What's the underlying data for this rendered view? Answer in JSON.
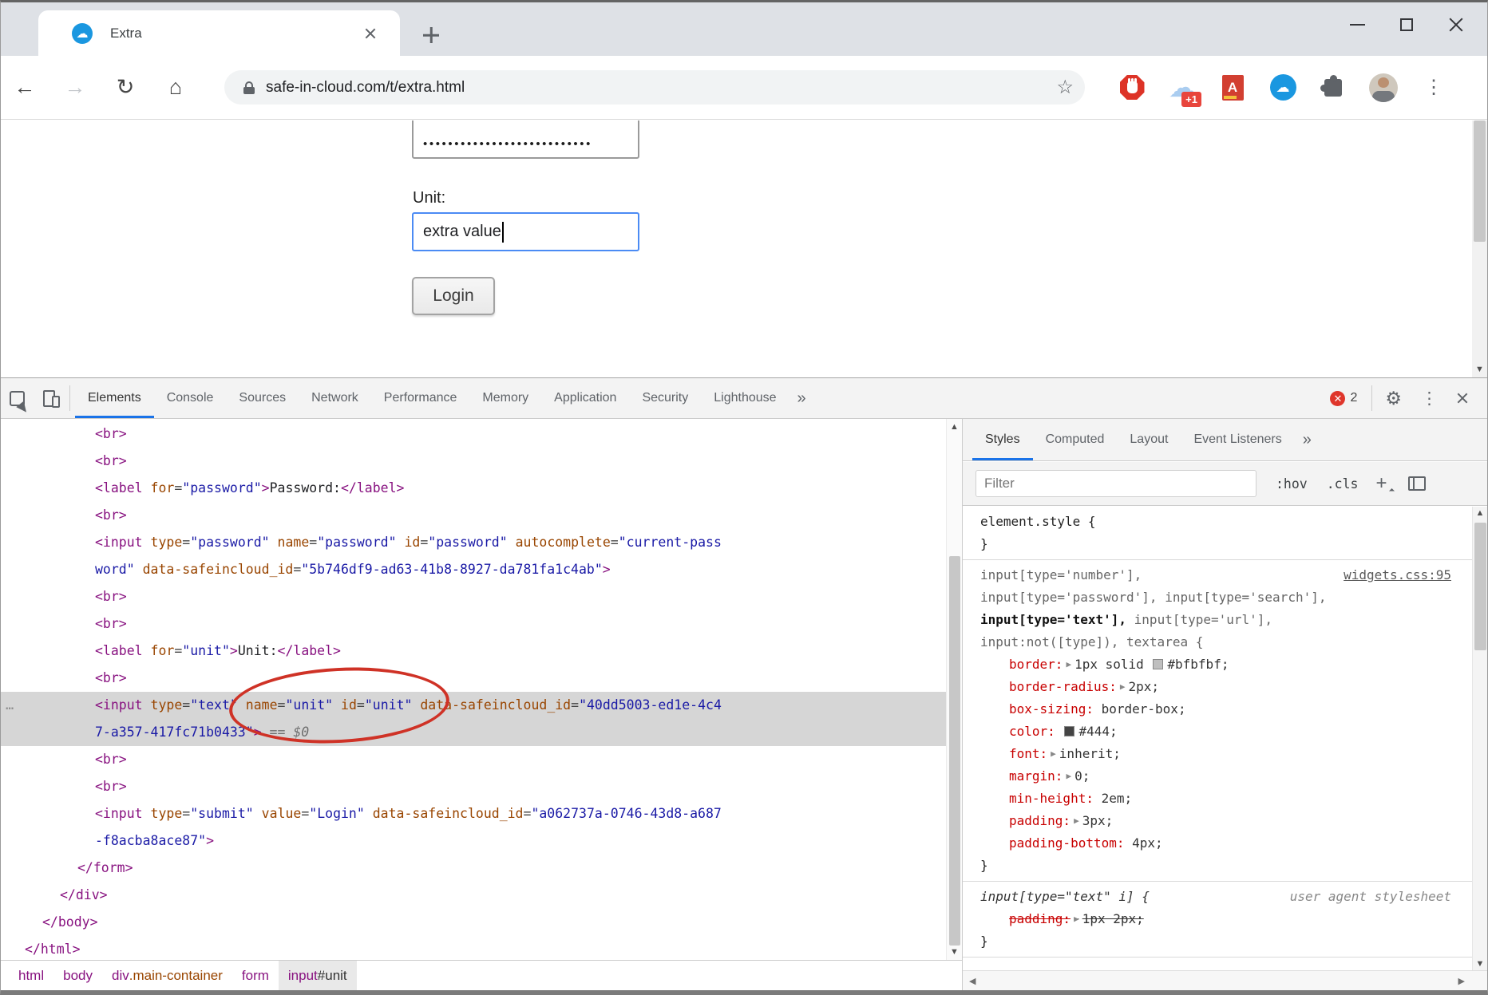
{
  "browser": {
    "tab_title": "Extra",
    "url": "safe-in-cloud.com/t/extra.html",
    "extensions": {
      "adblock_badge": "+1",
      "dictionary_letter": "A"
    }
  },
  "page": {
    "password_dots": "•••••••••••••••••••••••••••",
    "unit_label": "Unit:",
    "unit_value": "extra value",
    "login_label": "Login"
  },
  "devtools": {
    "tabs": [
      {
        "label": "Elements",
        "active": true
      },
      {
        "label": "Console"
      },
      {
        "label": "Sources"
      },
      {
        "label": "Network"
      },
      {
        "label": "Performance"
      },
      {
        "label": "Memory"
      },
      {
        "label": "Application"
      },
      {
        "label": "Security"
      },
      {
        "label": "Lighthouse"
      }
    ],
    "tabs_overflow": "»",
    "error_count": "2",
    "dom_lines": [
      {
        "ind": 4,
        "seg": [
          [
            "tag",
            "<br>"
          ]
        ]
      },
      {
        "ind": 4,
        "seg": [
          [
            "tag",
            "<br>"
          ]
        ]
      },
      {
        "ind": 4,
        "seg": [
          [
            "tag",
            "<label"
          ],
          [
            "pun",
            " "
          ],
          [
            "attr",
            "for"
          ],
          [
            "pun",
            "="
          ],
          [
            "val",
            "\"password\""
          ],
          [
            "tag",
            ">"
          ],
          [
            "txt",
            "Password:"
          ],
          [
            "tag",
            "</label>"
          ]
        ]
      },
      {
        "ind": 4,
        "seg": [
          [
            "tag",
            "<br>"
          ]
        ]
      },
      {
        "ind": 4,
        "seg": [
          [
            "tag",
            "<input"
          ],
          [
            "pun",
            " "
          ],
          [
            "attr",
            "type"
          ],
          [
            "pun",
            "="
          ],
          [
            "val",
            "\"password\""
          ],
          [
            "pun",
            " "
          ],
          [
            "attr",
            "name"
          ],
          [
            "pun",
            "="
          ],
          [
            "val",
            "\"password\""
          ],
          [
            "pun",
            " "
          ],
          [
            "attr",
            "id"
          ],
          [
            "pun",
            "="
          ],
          [
            "val",
            "\"password\""
          ],
          [
            "pun",
            " "
          ],
          [
            "attr",
            "autocomplete"
          ],
          [
            "pun",
            "="
          ],
          [
            "val",
            "\"current-pass"
          ]
        ]
      },
      {
        "ind": 4,
        "seg": [
          [
            "val",
            "word\""
          ],
          [
            "pun",
            " "
          ],
          [
            "attr",
            "data-safeincloud_id"
          ],
          [
            "pun",
            "="
          ],
          [
            "val",
            "\"5b746df9-ad63-41b8-8927-da781fa1c4ab\""
          ],
          [
            "tag",
            ">"
          ]
        ]
      },
      {
        "ind": 4,
        "seg": [
          [
            "tag",
            "<br>"
          ]
        ]
      },
      {
        "ind": 4,
        "seg": [
          [
            "tag",
            "<br>"
          ]
        ]
      },
      {
        "ind": 4,
        "seg": [
          [
            "tag",
            "<label"
          ],
          [
            "pun",
            " "
          ],
          [
            "attr",
            "for"
          ],
          [
            "pun",
            "="
          ],
          [
            "val",
            "\"unit\""
          ],
          [
            "tag",
            ">"
          ],
          [
            "txt",
            "Unit:"
          ],
          [
            "tag",
            "</label>"
          ]
        ]
      },
      {
        "ind": 4,
        "seg": [
          [
            "tag",
            "<br>"
          ]
        ]
      },
      {
        "ind": 4,
        "hl": true,
        "gutter": "…",
        "seg": [
          [
            "tag",
            "<input"
          ],
          [
            "pun",
            " "
          ],
          [
            "attr",
            "type"
          ],
          [
            "pun",
            "="
          ],
          [
            "val",
            "\"text\""
          ],
          [
            "pun",
            " "
          ],
          [
            "attr",
            "name"
          ],
          [
            "pun",
            "="
          ],
          [
            "val",
            "\"unit\""
          ],
          [
            "pun",
            " "
          ],
          [
            "attr",
            "id"
          ],
          [
            "pun",
            "="
          ],
          [
            "val",
            "\"unit\""
          ],
          [
            "pun",
            " "
          ],
          [
            "attr",
            "data-safeincloud_id"
          ],
          [
            "pun",
            "="
          ],
          [
            "val",
            "\"40dd5003-ed1e-4c4"
          ]
        ]
      },
      {
        "ind": 4,
        "hl": true,
        "seg": [
          [
            "val",
            "7-a357-417fc71b0433\""
          ],
          [
            "tag",
            ">"
          ],
          [
            "meta",
            " == $0"
          ]
        ]
      },
      {
        "ind": 4,
        "seg": [
          [
            "tag",
            "<br>"
          ]
        ]
      },
      {
        "ind": 4,
        "seg": [
          [
            "tag",
            "<br>"
          ]
        ]
      },
      {
        "ind": 4,
        "seg": [
          [
            "tag",
            "<input"
          ],
          [
            "pun",
            " "
          ],
          [
            "attr",
            "type"
          ],
          [
            "pun",
            "="
          ],
          [
            "val",
            "\"submit\""
          ],
          [
            "pun",
            " "
          ],
          [
            "attr",
            "value"
          ],
          [
            "pun",
            "="
          ],
          [
            "val",
            "\"Login\""
          ],
          [
            "pun",
            " "
          ],
          [
            "attr",
            "data-safeincloud_id"
          ],
          [
            "pun",
            "="
          ],
          [
            "val",
            "\"a062737a-0746-43d8-a687"
          ]
        ]
      },
      {
        "ind": 4,
        "seg": [
          [
            "val",
            "-f8acba8ace87\""
          ],
          [
            "tag",
            ">"
          ]
        ]
      },
      {
        "ind": 3,
        "seg": [
          [
            "tag",
            "</form>"
          ]
        ]
      },
      {
        "ind": 2,
        "seg": [
          [
            "tag",
            "</div>"
          ]
        ]
      },
      {
        "ind": 1,
        "seg": [
          [
            "tag",
            "</body>"
          ]
        ]
      },
      {
        "ind": 0,
        "seg": [
          [
            "tag",
            "</html>"
          ]
        ]
      }
    ],
    "breadcrumbs": [
      {
        "seg": [
          [
            "tag",
            "html"
          ]
        ]
      },
      {
        "seg": [
          [
            "tag",
            "body"
          ]
        ]
      },
      {
        "seg": [
          [
            "tag",
            "div"
          ],
          [
            "cls",
            ".main-container"
          ]
        ]
      },
      {
        "seg": [
          [
            "tag",
            "form"
          ]
        ]
      },
      {
        "seg": [
          [
            "tag",
            "input"
          ],
          [
            "idc",
            "#unit"
          ]
        ],
        "selected": true
      }
    ],
    "sidebar": {
      "tabs": [
        {
          "label": "Styles",
          "active": true
        },
        {
          "label": "Computed"
        },
        {
          "label": "Layout"
        },
        {
          "label": "Event Listeners"
        }
      ],
      "tabs_overflow": "»",
      "filter_placeholder": "Filter",
      "pseudo_toggle": ":hov",
      "class_toggle": ".cls",
      "style_sections": [
        {
          "rows": [
            {
              "kind": "sel",
              "parts": [
                {
                  "t": "element.style {",
                  "m": "dark"
                }
              ]
            },
            {
              "kind": "close",
              "t": "}"
            }
          ]
        },
        {
          "rows": [
            {
              "kind": "sel",
              "parts": [
                {
                  "t": "input[type='number'],",
                  "m": "dim"
                }
              ],
              "link": "widgets.css:95"
            },
            {
              "kind": "sel",
              "parts": [
                {
                  "t": "input[type='password'], input[type='search'],",
                  "m": "dim"
                }
              ]
            },
            {
              "kind": "sel",
              "parts": [
                {
                  "t": "input[type='text'],",
                  "m": "match"
                },
                {
                  "t": " input[type='url'],",
                  "m": "dim"
                }
              ]
            },
            {
              "kind": "sel",
              "parts": [
                {
                  "t": "input:not([type]), textarea {",
                  "m": "dim"
                }
              ]
            },
            {
              "kind": "prop",
              "name": "border",
              "arrow": true,
              "pre": "1px solid ",
              "swatch": "#bfbfbf",
              "value": "#bfbfbf;"
            },
            {
              "kind": "prop",
              "name": "border-radius",
              "arrow": true,
              "value": "2px;"
            },
            {
              "kind": "prop",
              "name": "box-sizing",
              "value": "border-box;"
            },
            {
              "kind": "prop",
              "name": "color",
              "swatch": "#444444",
              "value": "#444;"
            },
            {
              "kind": "prop",
              "name": "font",
              "arrow": true,
              "value": "inherit;"
            },
            {
              "kind": "prop",
              "name": "margin",
              "arrow": true,
              "value": "0;"
            },
            {
              "kind": "prop",
              "name": "min-height",
              "value": "2em;"
            },
            {
              "kind": "prop",
              "name": "padding",
              "arrow": true,
              "value": "3px;"
            },
            {
              "kind": "prop",
              "name": "padding-bottom",
              "value": "4px;"
            },
            {
              "kind": "close",
              "t": "}"
            }
          ]
        },
        {
          "rows": [
            {
              "kind": "sel",
              "parts": [
                {
                  "t": "input[type=\"text\" i] {",
                  "m": "ua"
                }
              ],
              "note": "user agent stylesheet"
            },
            {
              "kind": "prop",
              "name": "padding",
              "arrow": true,
              "value": "1px 2px;",
              "struck": true
            },
            {
              "kind": "close",
              "t": "}"
            }
          ]
        }
      ]
    }
  },
  "colors": {
    "accent": "#1a73e8",
    "error": "#df362b",
    "annotation": "#cf3226",
    "focus_border": "#4b8bf4"
  }
}
